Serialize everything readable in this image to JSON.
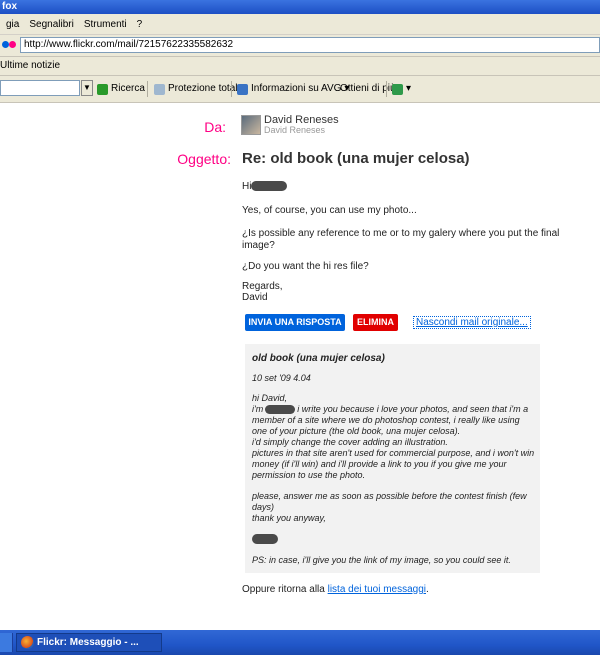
{
  "window": {
    "title": "fox"
  },
  "menu": [
    "gia",
    "Segnalibri",
    "Strumenti",
    "?"
  ],
  "address": {
    "url": "http://www.flickr.com/mail/72157622335582632"
  },
  "bookmarks": {
    "label": "Ultime notizie"
  },
  "toolbar": {
    "search_label": "Ricerca",
    "protection_label": "Protezione totale",
    "avg_label": "Informazioni su AVG",
    "more_label": "Ottieni di più"
  },
  "message": {
    "from_label": "Da:",
    "from_name": "David Reneses",
    "from_sub": "David Reneses",
    "subject_label": "Oggetto:",
    "subject": "Re: old book (una mujer celosa)",
    "greeting": "Hi",
    "line1": "Yes, of course, you can use my photo...",
    "line2a": "¿Is possible any reference to me or to my galery where you put the final",
    "line2b": "image?",
    "line3": "¿Do you want the hi res file?",
    "regards": "Regards,",
    "signature": "David"
  },
  "actions": {
    "reply_label": "INVIA UNA RISPOSTA",
    "delete_label": "ELIMINA",
    "hide_label": "Nascondi mail originale..."
  },
  "original": {
    "title": "old book (una mujer celosa)",
    "date": "10 set '09 4.04",
    "hi": "hi David,",
    "im": "i'm",
    "l1": "i write you because i love your photos, and seen that i'm a",
    "l2": "member of a site where we do photoshop contest, i really like using",
    "l3": "one of your picture (the old book, una mujer celosa).",
    "l4": "i'd simply change the cover adding an illustration.",
    "l5": "pictures in that site aren't used for commercial purpose, and i won't win",
    "l6": "money (if i'll win) and i'll provide a link to you if you give me your",
    "l7": "permission to use the photo.",
    "l8": "please, answer me as soon as possible before the contest finish (few",
    "l9": "days)",
    "l10": "thank you anyway,",
    "ps": "PS: in case, i'll give you the link of my image, so you could see it."
  },
  "footer": {
    "prefix": "Oppure ritorna alla",
    "link": "lista dei tuoi messaggi",
    "suffix": "."
  },
  "taskbar": {
    "item_label": "Flickr: Messaggio - ..."
  },
  "colors": {
    "flickr_pink": "#ff0084",
    "flickr_blue": "#0063dc",
    "delete_red": "#e10000"
  }
}
